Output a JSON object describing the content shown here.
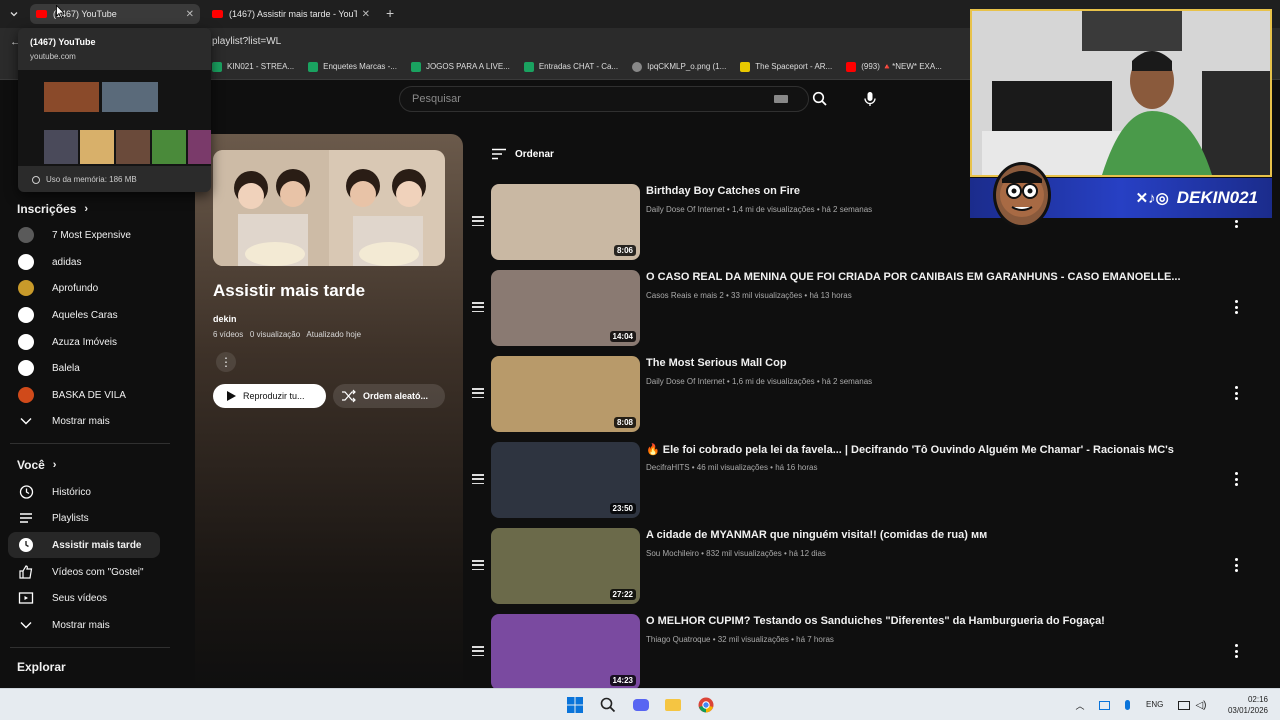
{
  "browser": {
    "tabs": [
      {
        "label": "(1467) YouTube",
        "active": true
      },
      {
        "label": "(1467) Assistir mais tarde - YouT",
        "active": false
      }
    ],
    "new_tab_label": "+",
    "url_fragment": "playlist?list=WL",
    "bookmarks": [
      {
        "label": "KIN021 - STREA...",
        "color": "#1aa260"
      },
      {
        "label": "Enquetes Marcas -...",
        "color": "#1aa260"
      },
      {
        "label": "JOGOS PARA A LIVE...",
        "color": "#1aa260"
      },
      {
        "label": "Entradas CHAT - Ca...",
        "color": "#1aa260"
      },
      {
        "label": "IpqCKMLP_o.png (1...",
        "color": "#888888"
      },
      {
        "label": "The Spaceport - AR...",
        "color": "#e8c800"
      },
      {
        "label": "(993) 🔺*NEW* EXA...",
        "color": "#ff0000"
      }
    ]
  },
  "tab_preview": {
    "title": "(1467) YouTube",
    "domain": "youtube.com",
    "memory": "Uso da memória: 186 MB"
  },
  "search": {
    "placeholder": "Pesquisar"
  },
  "sidebar": {
    "subscriptions_title": "Inscrições",
    "subscriptions": [
      {
        "label": "7 Most Expensive",
        "color": "#5a5a5a"
      },
      {
        "label": "adidas",
        "color": "#ffffff"
      },
      {
        "label": "Aprofundo",
        "color": "#c89a2a"
      },
      {
        "label": "Aqueles Caras",
        "color": "#ffffff"
      },
      {
        "label": "Azuza Imóveis",
        "color": "#ffffff"
      },
      {
        "label": "Balela",
        "color": "#ffffff"
      },
      {
        "label": "BASKA DE VILA",
        "color": "#d04a1a"
      }
    ],
    "show_more_1": "Mostrar mais",
    "you_title": "Você",
    "you_items": [
      {
        "label": "Histórico",
        "icon": "history-icon"
      },
      {
        "label": "Playlists",
        "icon": "playlists-icon"
      },
      {
        "label": "Assistir mais tarde",
        "icon": "clock-icon",
        "active": true
      },
      {
        "label": "Vídeos com \"Gostei\"",
        "icon": "thumbs-up-icon"
      },
      {
        "label": "Seus vídeos",
        "icon": "video-icon"
      }
    ],
    "show_more_2": "Mostrar mais",
    "explore_title": "Explorar"
  },
  "playlist": {
    "title": "Assistir mais tarde",
    "author": "dekin",
    "meta": "6 vídeos   0 visualização   Atualizado hoje",
    "play_all": "Reproduzir tu...",
    "shuffle": "Ordem aleató..."
  },
  "sort_label": "Ordenar",
  "videos": [
    {
      "title": "Birthday Boy Catches on Fire",
      "meta": "Daily Dose Of Internet • 1,4 mi de visualizações • há 2 semanas",
      "duration": "8:06",
      "thumb": "#c9b8a3"
    },
    {
      "title": "O CASO REAL DA MENINA QUE FOI CRIADA POR CANIBAIS EM GARANHUNS - CASO EMANOELLE...",
      "meta": "Casos Reais e mais 2 • 33 mil visualizações • há 13 horas",
      "duration": "14:04",
      "thumb": "#8a7a72"
    },
    {
      "title": "The Most Serious Mall Cop",
      "meta": "Daily Dose Of Internet • 1,6 mi de visualizações • há 2 semanas",
      "duration": "8:08",
      "thumb": "#b89a6a"
    },
    {
      "title": "🔥 Ele foi cobrado pela lei da favela... | Decifrando 'Tô Ouvindo Alguém Me Chamar' - Racionais MC's",
      "meta": "DecifraHITS • 46 mil visualizações • há 16 horas",
      "duration": "23:50",
      "thumb": "#2e3440"
    },
    {
      "title": "A cidade de MYANMAR que ninguém visita!! (comidas de rua) ᴍᴍ",
      "meta": "Sou Mochileiro • 832 mil visualizações • há 12 dias",
      "duration": "27:22",
      "thumb": "#6b6a4a"
    },
    {
      "title": "O MELHOR CUPIM? Testando os Sanduiches \"Diferentes\" da Hamburgueria do Fogaça!",
      "meta": "Thiago Quatroque • 32 mil visualizações • há 7 horas",
      "duration": "14:23",
      "thumb": "#7a4aa0"
    }
  ],
  "overlay": {
    "banner": "DEKIN021"
  },
  "taskbar": {
    "lang": "ENG",
    "time": "02:16",
    "date": "03/01/2026"
  }
}
